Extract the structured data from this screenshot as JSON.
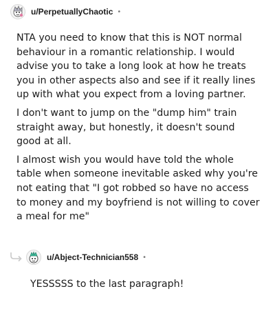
{
  "comment": {
    "username": "u/PerpetuallyChaotic",
    "separator": "•",
    "avatar_icon": "snoo-avatar-icon",
    "paragraphs": [
      "NTA you need to know that this is NOT normal behaviour in a romantic relationship. I would advise you to take a long look at how he treats you in other aspects also and see if it really lines up with what you expect from a loving partner.",
      "I don't want to jump on the \"dump him\" train straight away, but honestly, it doesn't sound good at all.",
      "I almost wish you would have told the whole table when someone inevitable asked why you're not eating that \"I got robbed so have no access to money and my boyfriend is not willing to cover a meal for me\""
    ]
  },
  "reply": {
    "username": "u/Abject-Technician558",
    "separator": "•",
    "avatar_icon": "snoo-avatar-icon",
    "text": "YESSSSS to the last paragraph!"
  },
  "colors": {
    "text": "#1c1c1c",
    "muted": "#7c7c7c",
    "thread_line": "#c8c8c8"
  }
}
